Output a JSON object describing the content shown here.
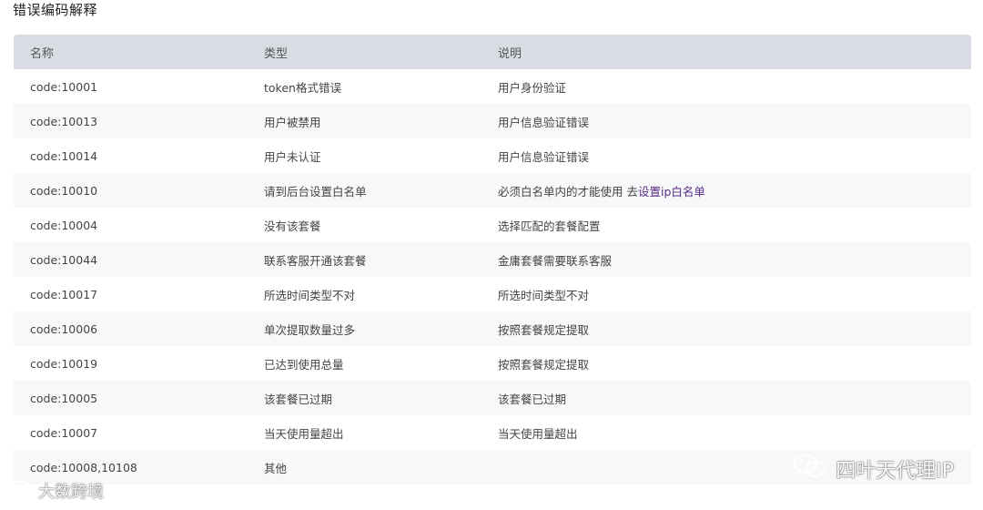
{
  "page": {
    "title": "错误编码解释"
  },
  "table": {
    "headers": [
      "名称",
      "类型",
      "说明"
    ],
    "rows": [
      {
        "code": "code:10001",
        "type": "token格式错误",
        "desc": "用户身份验证"
      },
      {
        "code": "code:10013",
        "type": "用户被禁用",
        "desc": "用户信息验证错误"
      },
      {
        "code": "code:10014",
        "type": "用户未认证",
        "desc": "用户信息验证错误"
      },
      {
        "code": "code:10010",
        "type": "请到后台设置白名单",
        "desc": "必须白名单内的才能使用 去",
        "link": "设置ip白名单"
      },
      {
        "code": "code:10004",
        "type": "没有该套餐",
        "desc": "选择匹配的套餐配置"
      },
      {
        "code": "code:10044",
        "type": "联系客服开通该套餐",
        "desc": "金庸套餐需要联系客服"
      },
      {
        "code": "code:10017",
        "type": "所选时间类型不对",
        "desc": "所选时间类型不对"
      },
      {
        "code": "code:10006",
        "type": "单次提取数量过多",
        "desc": "按照套餐规定提取"
      },
      {
        "code": "code:10019",
        "type": "已达到使用总量",
        "desc": "按照套餐规定提取"
      },
      {
        "code": "code:10005",
        "type": "该套餐已过期",
        "desc": "该套餐已过期"
      },
      {
        "code": "code:10007",
        "type": "当天使用量超出",
        "desc": "当天使用量超出"
      },
      {
        "code": "code:10008,10108",
        "type": "其他",
        "desc": ""
      }
    ]
  },
  "watermarks": {
    "left_text": "大数跨境",
    "right_text": "四叶天代理IP",
    "left_icon": "speech-bubble-logo-icon",
    "right_icon": "wechat-icon"
  },
  "colors": {
    "header_bg": "#d9dde3",
    "row_alt_bg": "#f7f8fa",
    "link": "#5a2a86"
  }
}
